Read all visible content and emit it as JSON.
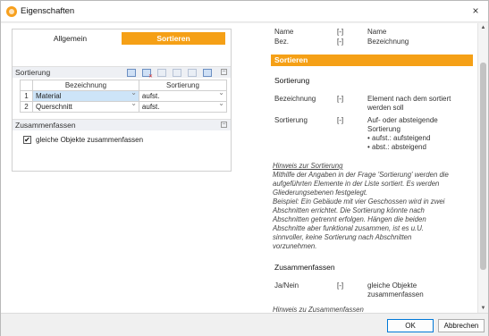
{
  "window": {
    "title": "Eigenschaften",
    "close_glyph": "×"
  },
  "tabs": [
    {
      "label": "Allgemein"
    },
    {
      "label": "Sortieren"
    }
  ],
  "sortierung": {
    "section_label": "Sortierung",
    "columns": [
      "Bezeichnung",
      "Sortierung"
    ],
    "rows": [
      {
        "num": "1",
        "bezeichnung": "Material",
        "sortierung": "aufst."
      },
      {
        "num": "2",
        "bezeichnung": "Querschnitt",
        "sortierung": "aufst."
      }
    ]
  },
  "zusammenfassen": {
    "section_label": "Zusammenfassen",
    "checkbox_label": "gleiche Objekte zusammenfassen",
    "checked": true,
    "check_glyph": "✔"
  },
  "help": {
    "rows_top": [
      {
        "name": "Name",
        "unit": "[-]",
        "desc": "Name"
      },
      {
        "name": "Bez.",
        "unit": "[-]",
        "desc": "Bezeichnung"
      }
    ],
    "band": "Sortieren",
    "sort_heading": "Sortierung",
    "sort_rows": [
      {
        "name": "Bezeichnung",
        "unit": "[-]",
        "desc1": "Element nach dem sortiert",
        "desc2": "werden soll"
      },
      {
        "name": "Sortierung",
        "unit": "[-]",
        "desc1": "Auf- oder absteigende",
        "desc2": "Sortierung",
        "desc3": "• aufst.: aufsteigend",
        "desc4": "• abst.: absteigend"
      }
    ],
    "hint_title": "Hinweis zur Sortierung",
    "hint_lines": [
      "Mithilfe der Angaben in der Frage 'Sortierung' werden die",
      "aufgeführten Elemente in der Liste sortiert. Es werden",
      "Gliederungsebenen festgelegt.",
      "Beispiel: Ein Gebäude mit vier Geschossen wird in zwei",
      "Abschnitten errichtet. Die Sortierung könnte nach",
      "Abschnitten getrennt erfolgen. Hängen die beiden",
      "Abschnitte aber funktional zusammen, ist es u.U.",
      "sinnvoller, keine Sortierung nach Abschnitten",
      "vorzunehmen."
    ],
    "zus_heading": "Zusammenfassen",
    "zus_row": {
      "name": "Ja/Nein",
      "unit": "[-]",
      "desc1": "gleiche Objekte",
      "desc2": "zusammenfassen"
    },
    "hint2_title": "Hinweis zu Zusammenfassen"
  },
  "buttons": {
    "ok": "OK",
    "cancel": "Abbrechen"
  },
  "scrollbar": {
    "up": "▲",
    "down": "▼"
  },
  "colors": {
    "accent": "#f5a016",
    "selection": "#cde4f8"
  }
}
